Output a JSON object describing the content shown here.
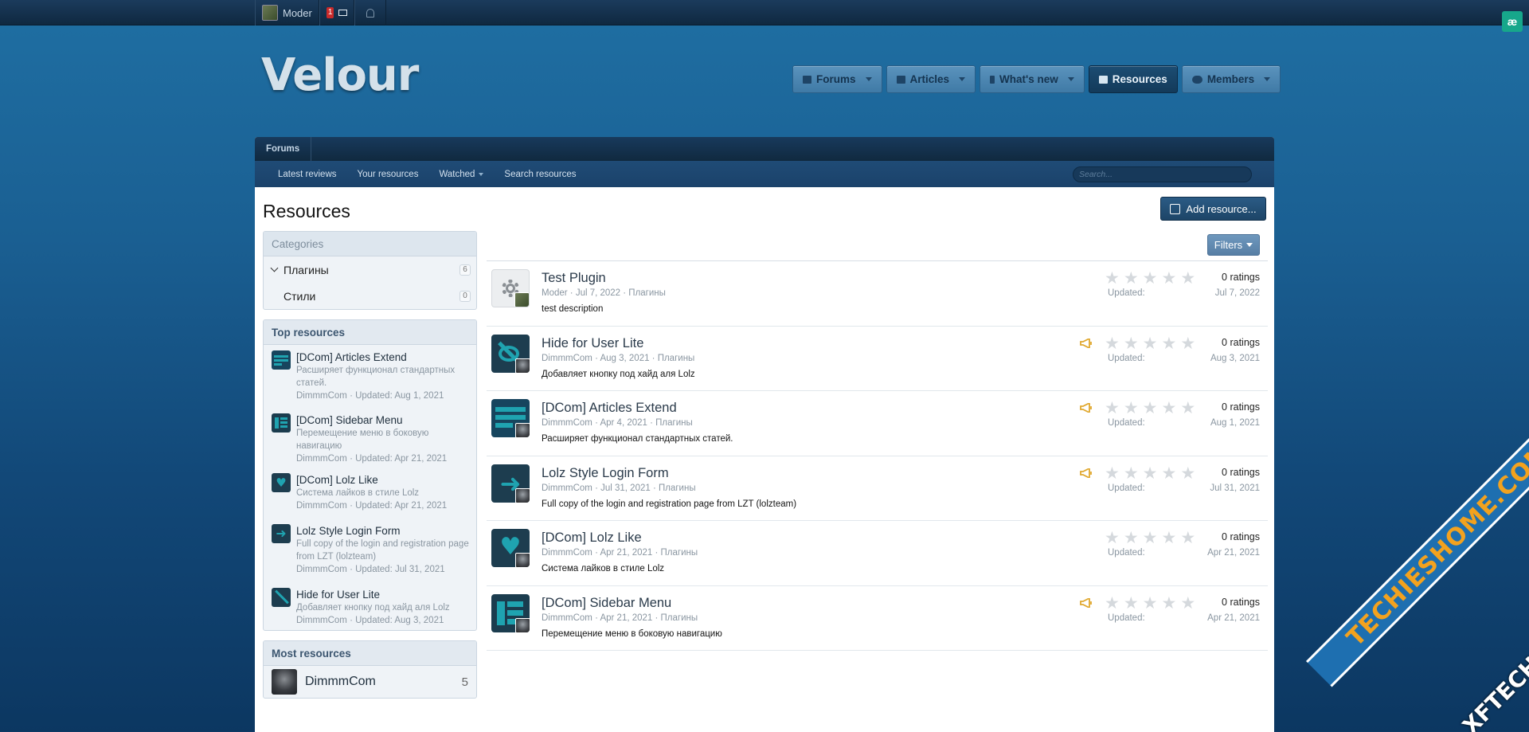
{
  "topbar": {
    "user": "Moder",
    "conversations_badge": "1"
  },
  "header": {
    "logo": "Velour"
  },
  "nav": {
    "tabs": [
      {
        "label": "Forums"
      },
      {
        "label": "Articles"
      },
      {
        "label": "What's new"
      },
      {
        "label": "Resources"
      },
      {
        "label": "Members"
      }
    ]
  },
  "breadcrumb": {
    "item": "Forums"
  },
  "subnav": {
    "latest_reviews": "Latest reviews",
    "your_resources": "Your resources",
    "watched": "Watched",
    "search_resources": "Search resources",
    "search_placeholder": "Search..."
  },
  "page": {
    "title": "Resources",
    "add_button": "Add resource...",
    "filters": "Filters"
  },
  "sidebar": {
    "categories_title": "Categories",
    "categories": [
      {
        "name": "Плагины",
        "count": "6"
      },
      {
        "name": "Стили",
        "count": "0"
      }
    ],
    "top_title": "Top resources",
    "top": [
      {
        "title": "[DCom] Articles Extend",
        "desc": "Расширяет функционал стандартных статей.",
        "meta": "DimmmCom · Updated: Aug 1, 2021"
      },
      {
        "title": "[DCom] Sidebar Menu",
        "desc": "Перемещение меню в боковую навигацию",
        "meta": "DimmmCom · Updated: Apr 21, 2021"
      },
      {
        "title": "[DCom] Lolz Like",
        "desc": "Система лайков в стиле Lolz",
        "meta": "DimmmCom · Updated: Apr 21, 2021"
      },
      {
        "title": "Lolz Style Login Form",
        "desc": "Full copy of the login and registration page from LZT (lolzteam)",
        "meta": "DimmmCom · Updated: Jul 31, 2021"
      },
      {
        "title": "Hide for User Lite",
        "desc": "Добавляет кнопку под хайд аля Lolz",
        "meta": "DimmmCom · Updated: Aug 3, 2021"
      }
    ],
    "most_title": "Most resources",
    "most": [
      {
        "name": "DimmmCom",
        "count": "5"
      }
    ]
  },
  "resources": [
    {
      "title": "Test Plugin",
      "meta": "Moder · Jul 7, 2022 · Плагины",
      "desc": "test description",
      "ratings": "0 ratings",
      "updated_label": "Updated:",
      "updated": "Jul 7, 2022",
      "icon": "gear-icon"
    },
    {
      "title": "Hide for User Lite",
      "meta": "DimmmCom · Aug 3, 2021 · Плагины",
      "desc": "Добавляет кнопку под хайд аля Lolz",
      "ratings": "0 ratings",
      "updated_label": "Updated:",
      "updated": "Aug 3, 2021",
      "icon": "eye-slash-icon"
    },
    {
      "title": "[DCom] Articles Extend",
      "meta": "DimmmCom · Apr 4, 2021 · Плагины",
      "desc": "Расширяет функционал стандартных статей.",
      "ratings": "0 ratings",
      "updated_label": "Updated:",
      "updated": "Aug 1, 2021",
      "icon": "articles-icon"
    },
    {
      "title": "Lolz Style Login Form",
      "meta": "DimmmCom · Jul 31, 2021 · Плагины",
      "desc": "Full copy of the login and registration page from LZT (lolzteam)",
      "ratings": "0 ratings",
      "updated_label": "Updated:",
      "updated": "Jul 31, 2021",
      "icon": "login-arrow-icon"
    },
    {
      "title": "[DCom] Lolz Like",
      "meta": "DimmmCom · Apr 21, 2021 · Плагины",
      "desc": "Система лайков в стиле Lolz",
      "ratings": "0 ratings",
      "updated_label": "Updated:",
      "updated": "Apr 21, 2021",
      "icon": "heart-icon"
    },
    {
      "title": "[DCom] Sidebar Menu",
      "meta": "DimmmCom · Apr 21, 2021 · Плагины",
      "desc": "Перемещение меню в боковую навигацию",
      "ratings": "0 ratings",
      "updated_label": "Updated:",
      "updated": "Apr 21, 2021",
      "icon": "sidebar-menu-icon"
    }
  ],
  "watermark": {
    "text": "TECHIESHOME.COM",
    "text2": "XFTECH"
  },
  "colors": {
    "accent": "#1d4567",
    "teal": "#1fa3b0",
    "featured": "#e0a82e"
  }
}
